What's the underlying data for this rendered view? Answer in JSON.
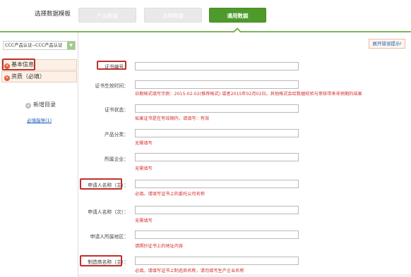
{
  "template": {
    "label": "选择数据模板",
    "buttons": [
      "产品数据",
      "品牌数据",
      "通用数据"
    ]
  },
  "sidebar": {
    "category_select": "CCC产品认证--CCC产品认证",
    "sections": [
      "基本信息",
      "资质（必填）"
    ],
    "add_directory": "新增目录",
    "guide_link": "必填指导(1)"
  },
  "main": {
    "error_tip": "展开错误提示!",
    "fields": [
      {
        "label": "证书编号：",
        "hint": ""
      },
      {
        "label": "证书生效时间：",
        "hint": "日期格式填写示例：2015-02-02(推荐格式) 或者2015年02月02日。其他格式会给数据校验与审核带来非预期的结果"
      },
      {
        "label": "证书状态：",
        "hint": "如果证书是在有效期内，请填写：有效"
      },
      {
        "label": "产品分类：",
        "hint": "无需填写"
      },
      {
        "label": "所属企业：",
        "hint": "无需填写"
      },
      {
        "label": "申请人名称（主）：",
        "hint": "必填。请填写证书上的委托公司名称"
      },
      {
        "label": "申请人名称（次）：",
        "hint": "无需填写"
      },
      {
        "label": "申请人所属地区：",
        "hint": "请照抄证书上的地址内容"
      },
      {
        "label": "制造商名称（主）：",
        "hint": "必填。请填写证书上制造商名称，请勿填写生产企业名称"
      }
    ]
  },
  "colors": {
    "accent_green": "#4e9a2b",
    "highlight_red": "#c0302a",
    "hint_red": "#d62f2f",
    "link_blue": "#1b5db5"
  }
}
